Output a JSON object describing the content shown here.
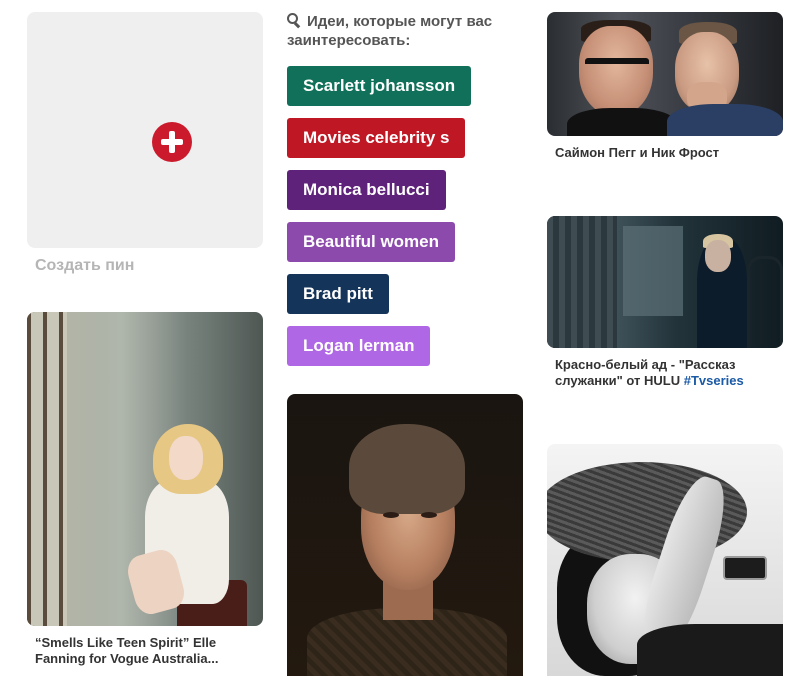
{
  "create_pin": {
    "label": "Создать пин"
  },
  "ideas": {
    "heading": "Идеи, которые могут вас заинтересовать:",
    "chips": [
      {
        "label": "Scarlett johansson",
        "color": "#11705a"
      },
      {
        "label": "Movies celebrity s",
        "color": "#c01724"
      },
      {
        "label": "Monica bellucci",
        "color": "#5f227a"
      },
      {
        "label": "Beautiful women",
        "color": "#8c4bac"
      },
      {
        "label": "Brad pitt",
        "color": "#143459"
      },
      {
        "label": "Logan lerman",
        "color": "#b067e5"
      }
    ]
  },
  "pins": [
    {
      "caption": "Саймон Пегг и Ник Фрост"
    },
    {
      "caption": "Красно-белый ад - \"Рассказ служанки\" от HULU",
      "tag": "#Tvseries"
    },
    {
      "caption": "“Smells Like Teen Spirit” Elle Fanning for Vogue Australia..."
    }
  ]
}
